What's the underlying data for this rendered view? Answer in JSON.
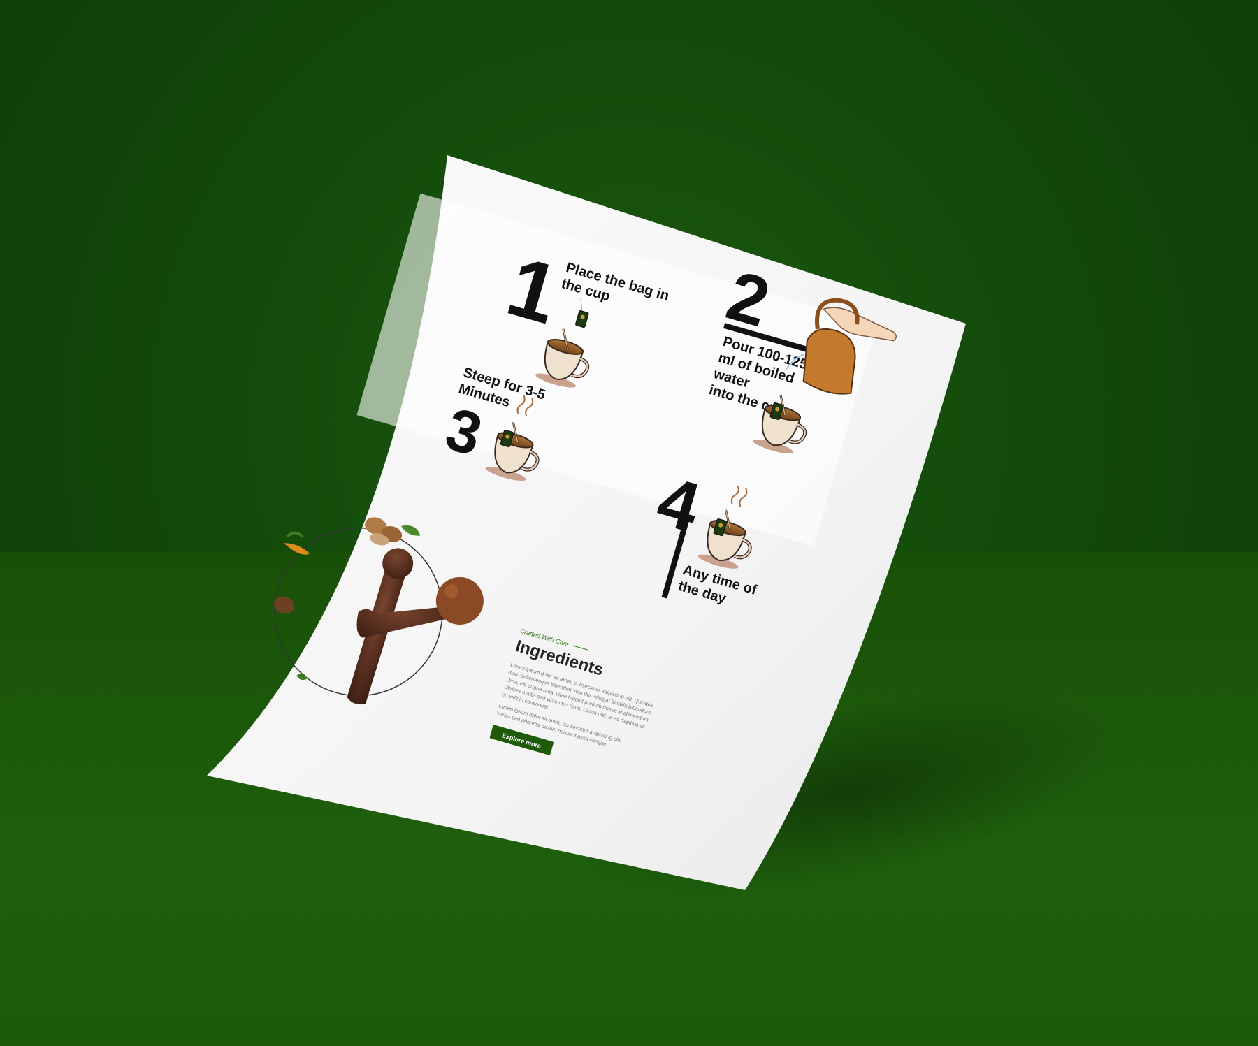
{
  "steps": [
    {
      "number": "1",
      "text_line1": "Place the bag in",
      "text_line2": "the cup"
    },
    {
      "number": "2",
      "text_line1": "Pour 100-125",
      "text_line2": "ml of boiled",
      "text_line3": "water",
      "text_line4": "into the cup"
    },
    {
      "number": "3",
      "text_line1": "Steep for 3-5",
      "text_line2": "Minutes"
    },
    {
      "number": "4",
      "text_line1": "Any time of",
      "text_line2": "the day"
    }
  ],
  "ingredients": {
    "eyebrow": "Crafted With Care",
    "title": "Ingredients",
    "body_lines": [
      "Lorem ipsum dolor sit amet, consectetur adipiscing elit. Quisque",
      "diam pellentesque bibendum non dui volutpat fringilla bibendum.",
      "Urna, elit augue urna, vitae feugiat pretium donec id elementum.",
      "Ultrices mattis sed vitae mus risus. Lacus nisl, et ac dapibus sit",
      "eu velit in consequat.",
      "Lorem ipsum dolor sit amet, consectetur adipiscing elit.",
      "Varius sed pharetra dictum neque massa congue"
    ],
    "button_label": "Explore more"
  },
  "colors": {
    "background": "#134a0a",
    "paper": "#f6f6f6",
    "accent_green": "#1d5b0b",
    "ink": "#111111",
    "tea_brown": "#8b5a2b"
  }
}
